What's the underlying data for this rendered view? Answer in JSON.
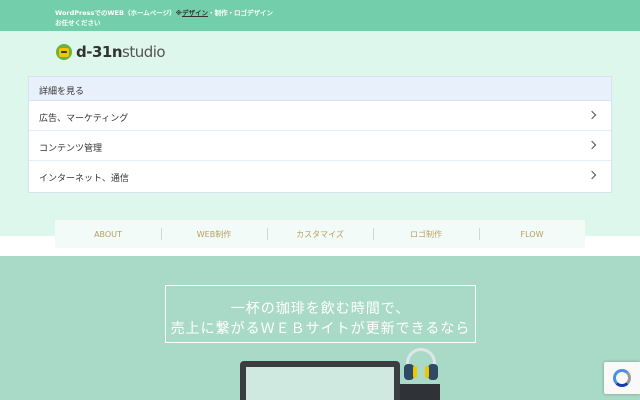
{
  "topbar": {
    "text_prefix": "WordPressでのWEB（ホームページ）",
    "link_text": "デザイン",
    "text_suffix": "・制作・ロゴデザインお任せください",
    "prefix_mark": "※"
  },
  "logo": {
    "text_bold": "d-31n",
    "text_light": "studio",
    "icon": "studio-logo-icon"
  },
  "details": {
    "heading": "詳細を見る",
    "items": [
      {
        "label": "広告、マーケティング",
        "icon": "chevron-right-icon"
      },
      {
        "label": "コンテンツ管理",
        "icon": "chevron-right-icon"
      },
      {
        "label": "インターネット、通信",
        "icon": "chevron-right-icon"
      }
    ]
  },
  "nav": {
    "items": [
      {
        "label": "ABOUT"
      },
      {
        "label": "WEB制作"
      },
      {
        "label": "カスタマイズ"
      },
      {
        "label": "ロゴ制作"
      },
      {
        "label": "FLOW"
      }
    ]
  },
  "hero": {
    "line1": "一杯の珈琲を飲む時間で、",
    "line2": "売上に繋がるＷＥＢサイトが更新できるなら",
    "illustration": "desk-monitor-headphones-illustration"
  },
  "recaptcha": {
    "icon": "recaptcha-icon"
  },
  "colors": {
    "topbar": "#73cfab",
    "header_bg": "#def7ec",
    "hero_bg": "#a9dac8",
    "nav_text": "#b8a060"
  }
}
